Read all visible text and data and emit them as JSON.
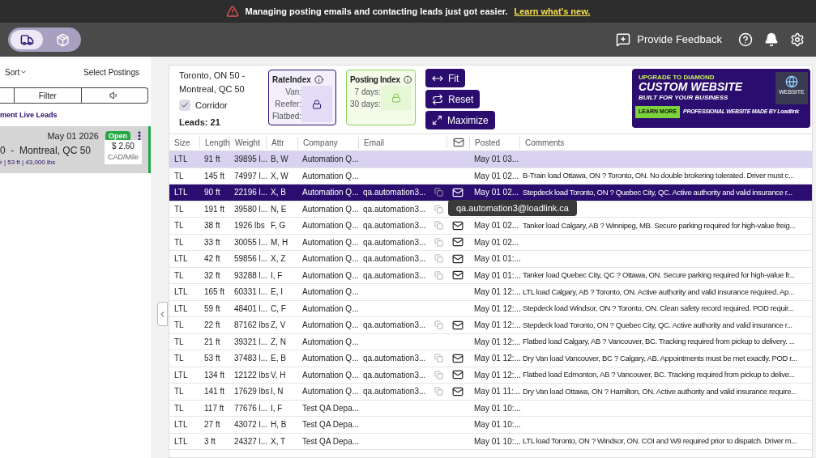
{
  "announcement": {
    "text": "Managing posting emails and contacting leads just got easier.",
    "link": "Learn what's new."
  },
  "header": {
    "modes": [
      {
        "kind": "truck",
        "selected": true
      },
      {
        "kind": "box",
        "selected": false
      }
    ],
    "feedback": "Provide Feedback"
  },
  "sidebar": {
    "sort": "Sort",
    "select": "Select Postings",
    "segments": [
      {
        "kind": "blank"
      },
      {
        "kind": "text",
        "label": "Filter"
      },
      {
        "kind": "speaker"
      }
    ],
    "section": "ment Live Leads",
    "card": {
      "date": "May 01 2026",
      "status": "Open",
      "route": "0  -  Montreal, QC 50",
      "details": "r | 53 ft | 43,000 lbs",
      "rate": "$ 2.60",
      "unit": "CAD/Mile"
    }
  },
  "summary": {
    "route_line1": "Toronto, ON 50 -",
    "route_line2": "Montreal, QC 50",
    "corridor": {
      "label": "Corridor",
      "checked": true
    },
    "leads": "Leads: 21"
  },
  "rate_index": {
    "title": "RateIndex",
    "rows": [
      "Van:",
      "Reefer:",
      "Flatbed:"
    ],
    "locked": true
  },
  "posting_index": {
    "title": "Posting Index",
    "rows": [
      "7 days:",
      "30 days:"
    ],
    "locked": true
  },
  "buttons": [
    {
      "kind": "fit",
      "label": "Fit"
    },
    {
      "kind": "reset",
      "label": "Reset"
    },
    {
      "kind": "maximize",
      "label": "Maximize"
    }
  ],
  "ad": {
    "kicker": "UPGRADE TO DIAMOND",
    "headline": "CUSTOM WEBSITE",
    "subhead": "BUILT FOR YOUR BUSINESS",
    "cta": "LEARN MORE",
    "footer": "PROFESSIONAL WEBSITE MADE BY Loadlink",
    "badge": "WEBSITE"
  },
  "table": {
    "columns": [
      "Size",
      "Length",
      "Weight",
      "Attr",
      "Company",
      "Email",
      "Posted",
      "Comments"
    ],
    "rows": [
      {
        "size": "LTL",
        "length": "91 ft",
        "weight": "39895 l...",
        "attr": "B, W",
        "company": "Automation Q...",
        "email": "",
        "posted": "May 01 03...",
        "comments": "",
        "selected": false,
        "highlighted": true
      },
      {
        "size": "TL",
        "length": "145 ft",
        "weight": "74997 l...",
        "attr": "X, W",
        "company": "Automation Q...",
        "email": "",
        "posted": "May 01 02...",
        "comments": "B-Train load Ottawa, ON ? Toronto, ON. No double brokering tolerated. Driver must c...",
        "selected": false,
        "highlighted": false
      },
      {
        "size": "LTL",
        "length": "90 ft",
        "weight": "22196 l...",
        "attr": "X, B",
        "company": "Automation Q...",
        "email": "qa.automation3...",
        "posted": "May 01 02...",
        "comments": "Stepdeck load Toronto, ON ? Quebec City, QC. Active authority and valid insurance r...",
        "selected": true,
        "highlighted": false
      },
      {
        "size": "TL",
        "length": "191 ft",
        "weight": "39580 l...",
        "attr": "N, E",
        "company": "Automation Q...",
        "email": "qa.automation3...",
        "posted": "",
        "comments": "",
        "selected": false,
        "highlighted": false,
        "tooltip": "qa.automation3@loadlink.ca"
      },
      {
        "size": "TL",
        "length": "38 ft",
        "weight": "1926 lbs",
        "attr": "F, G",
        "company": "Automation Q...",
        "email": "qa.automation3...",
        "posted": "May 01 02...",
        "comments": "Tanker load Calgary, AB ? Winnipeg, MB. Secure parking required for high-value freig...",
        "selected": false,
        "highlighted": false
      },
      {
        "size": "TL",
        "length": "33 ft",
        "weight": "30055 l...",
        "attr": "M, H",
        "company": "Automation Q...",
        "email": "qa.automation3...",
        "posted": "May 01 02...",
        "comments": "",
        "selected": false,
        "highlighted": false
      },
      {
        "size": "LTL",
        "length": "42 ft",
        "weight": "59856 l...",
        "attr": "X, Z",
        "company": "Automation Q...",
        "email": "qa.automation3...",
        "posted": "May 01 01:...",
        "comments": "",
        "selected": false,
        "highlighted": false
      },
      {
        "size": "TL",
        "length": "32 ft",
        "weight": "93288 l...",
        "attr": "I, F",
        "company": "Automation Q...",
        "email": "qa.automation3...",
        "posted": "May 01 01:...",
        "comments": "Tanker load Quebec City, QC ? Ottawa, ON. Secure parking required for high-value fr...",
        "selected": false,
        "highlighted": false
      },
      {
        "size": "LTL",
        "length": "165 ft",
        "weight": "60331 l...",
        "attr": "E, I",
        "company": "Automation Q...",
        "email": "",
        "posted": "May 01 12:...",
        "comments": "LTL load Calgary, AB ? Toronto, ON. Active authority and valid insurance required. Ap...",
        "selected": false,
        "highlighted": false
      },
      {
        "size": "LTL",
        "length": "59 ft",
        "weight": "48401 l...",
        "attr": "C, F",
        "company": "Automation Q...",
        "email": "",
        "posted": "May 01 12:...",
        "comments": "Stepdeck load Windsor, ON ? Toronto, ON. Clean safety record required. POD requir...",
        "selected": false,
        "highlighted": false
      },
      {
        "size": "TL",
        "length": "22 ft",
        "weight": "87162 lbs",
        "attr": "Z, V",
        "company": "Automation Q...",
        "email": "qa.automation3...",
        "posted": "May 01 12:...",
        "comments": "Stepdeck load Toronto, ON ? Quebec City, QC. Active authority and valid insurance r...",
        "selected": false,
        "highlighted": false
      },
      {
        "size": "TL",
        "length": "21 ft",
        "weight": "39321 l...",
        "attr": "Z, N",
        "company": "Automation Q...",
        "email": "",
        "posted": "May 01 12:...",
        "comments": "Flatbed load Calgary, AB ? Vancouver, BC. Tracking required from pickup to delivery. ...",
        "selected": false,
        "highlighted": false
      },
      {
        "size": "TL",
        "length": "53 ft",
        "weight": "37483 l...",
        "attr": "E, B",
        "company": "Automation Q...",
        "email": "qa.automation3...",
        "posted": "May 01 12:...",
        "comments": "Dry Van load Vancouver, BC ? Calgary, AB. Appointments must be met exactly. POD r...",
        "selected": false,
        "highlighted": false
      },
      {
        "size": "LTL",
        "length": "134 ft",
        "weight": "12122 lbs",
        "attr": "V, H",
        "company": "Automation Q...",
        "email": "qa.automation3...",
        "posted": "May 01 12:...",
        "comments": "Flatbed load Edmonton, AB ? Vancouver, BC. Tracking required from pickup to delive...",
        "selected": false,
        "highlighted": false
      },
      {
        "size": "TL",
        "length": "141 ft",
        "weight": "17629 lbs",
        "attr": "I, N",
        "company": "Automation Q...",
        "email": "qa.automation3...",
        "posted": "May 01 11:...",
        "comments": "Dry Van load Ottawa, ON ? Hamilton, ON. Active authority and valid insurance require...",
        "selected": false,
        "highlighted": false
      },
      {
        "size": "TL",
        "length": "117 ft",
        "weight": "77676 l...",
        "attr": "I, F",
        "company": "Test QA Depa...",
        "email": "",
        "posted": "May 01 10:...",
        "comments": "",
        "selected": false,
        "highlighted": false
      },
      {
        "size": "LTL",
        "length": "27 ft",
        "weight": "43072 l...",
        "attr": "H, B",
        "company": "Test QA Depa...",
        "email": "",
        "posted": "May 01 10:...",
        "comments": "",
        "selected": false,
        "highlighted": false
      },
      {
        "size": "LTL",
        "length": "3 ft",
        "weight": "24327 l...",
        "attr": "X, T",
        "company": "Test QA Depa...",
        "email": "",
        "posted": "May 01 10:...",
        "comments": "LTL load Toronto, ON ? Windsor, ON. COI and W9 required prior to dispatch. Driver m...",
        "selected": false,
        "highlighted": false
      }
    ]
  }
}
